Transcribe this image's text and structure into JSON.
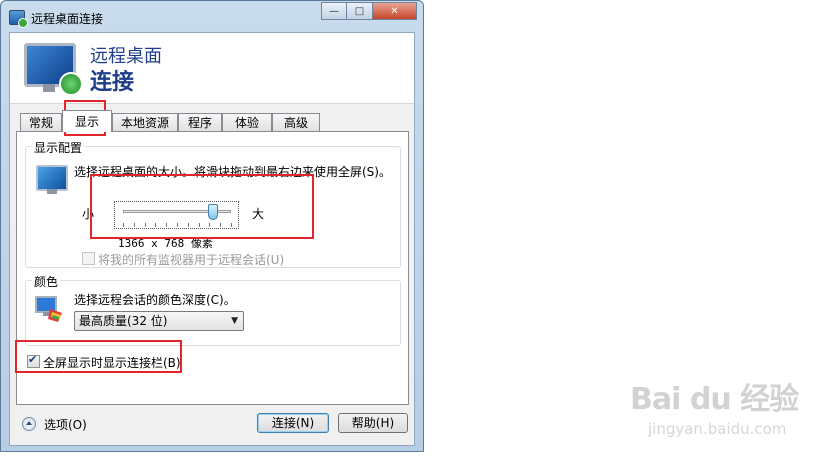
{
  "window": {
    "title": "远程桌面连接",
    "controls": {
      "minimize": "—",
      "maximize": "□",
      "close": "✕"
    }
  },
  "header": {
    "line1": "远程桌面",
    "line2": "连接"
  },
  "tabs": [
    {
      "label": "常规"
    },
    {
      "label": "显示",
      "active": true
    },
    {
      "label": "本地资源"
    },
    {
      "label": "程序"
    },
    {
      "label": "体验"
    },
    {
      "label": "高级"
    }
  ],
  "display_config": {
    "group_label": "显示配置",
    "description": "选择远程桌面的大小。将滑块拖动到最右边来使用全屏(S)。",
    "slider_min_label": "小",
    "slider_max_label": "大",
    "slider_value_fraction": 0.83,
    "resolution_text": "1366 x 768 像素",
    "monitors_checkbox_label": "将我的所有监视器用于远程会话(U)",
    "monitors_checked": false
  },
  "colors": {
    "group_label": "颜色",
    "description": "选择远程会话的颜色深度(C)。",
    "selected": "最高质量(32 位)"
  },
  "connection_bar": {
    "label": "全屏显示时显示连接栏(B)",
    "checked": true
  },
  "footer": {
    "options_label": "选项(O)",
    "connect_label": "连接(N)",
    "help_label": "帮助(H)"
  },
  "watermark": {
    "brand": "Bai du 经验",
    "url": "jingyan.baidu.com"
  },
  "highlight_color": "#e0262a"
}
